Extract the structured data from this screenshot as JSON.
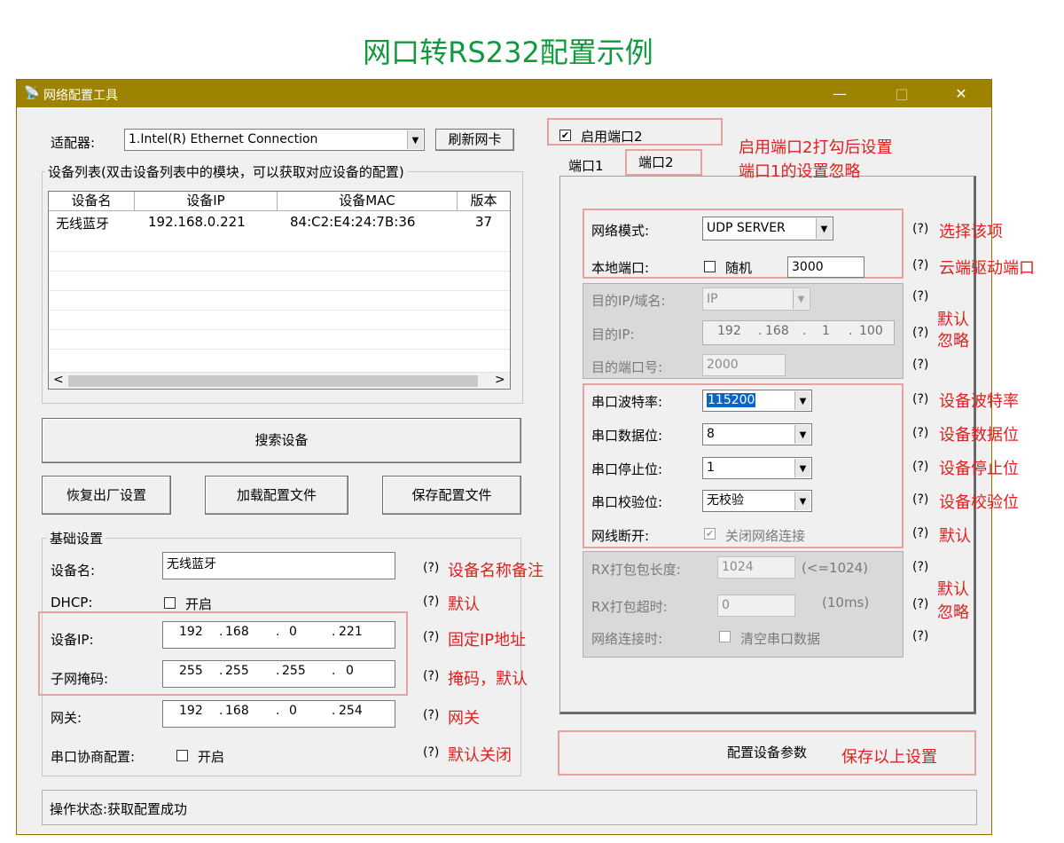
{
  "heading": "网口转RS232配置示例",
  "window": {
    "title": "网络配置工具",
    "minimize": "—",
    "maximize": "□",
    "close": "✕",
    "icon": "network-tool-icon"
  },
  "adapter": {
    "label": "适配器:",
    "value": "1.Intel(R) Ethernet Connection",
    "refresh_label": "刷新网卡"
  },
  "device_list": {
    "title": "设备列表(双击设备列表中的模块，可以获取对应设备的配置)",
    "columns": [
      "设备名",
      "设备IP",
      "设备MAC",
      "版本"
    ],
    "rows": [
      {
        "name": "无线蓝牙",
        "ip": "192.168.0.221",
        "mac": "84:C2:E4:24:7B:36",
        "version": "37"
      }
    ],
    "scroll_left": "<",
    "scroll_right": ">"
  },
  "buttons": {
    "search": "搜索设备",
    "factory_reset": "恢复出厂设置",
    "load_config": "加载配置文件",
    "save_config": "保存配置文件",
    "configure": "配置设备参数"
  },
  "basic": {
    "title": "基础设置",
    "device_name_label": "设备名:",
    "device_name_value": "无线蓝牙",
    "dhcp_label": "DHCP:",
    "dhcp_option": "开启",
    "ip_label": "设备IP:",
    "ip": [
      "192",
      "168",
      "0",
      "221"
    ],
    "mask_label": "子网掩码:",
    "mask": [
      "255",
      "255",
      "255",
      "0"
    ],
    "gateway_label": "网关:",
    "gateway": [
      "192",
      "168",
      "0",
      "254"
    ],
    "serial_neg_label": "串口协商配置:",
    "serial_neg_option": "开启"
  },
  "status": {
    "text": "操作状态:获取配置成功"
  },
  "port2": {
    "enable_label": "启用端口2",
    "enable_checked": "✔",
    "tabs": [
      "端口1",
      "端口2"
    ]
  },
  "port_settings": {
    "net_mode_label": "网络模式:",
    "net_mode_value": "UDP SERVER",
    "local_port_label": "本地端口:",
    "random_label": "随机",
    "local_port_value": "3000",
    "dest_host_label": "目的IP/域名:",
    "dest_host_value": "IP",
    "dest_ip_label": "目的IP:",
    "dest_ip": [
      "192",
      "168",
      "1",
      "100"
    ],
    "dest_port_label": "目的端口号:",
    "dest_port_value": "2000",
    "baud_label": "串口波特率:",
    "baud_value": "115200",
    "data_bits_label": "串口数据位:",
    "data_bits_value": "8",
    "stop_bits_label": "串口停止位:",
    "stop_bits_value": "1",
    "parity_label": "串口校验位:",
    "parity_value": "无校验",
    "disconnect_label": "网线断开:",
    "disconnect_option": "关闭网络连接",
    "disconnect_checked": "✔",
    "rx_len_label": "RX打包包长度:",
    "rx_len_value": "1024",
    "rx_len_hint": "(<=1024)",
    "rx_timeout_label": "RX打包超时:",
    "rx_timeout_value": "0",
    "rx_timeout_hint": "(10ms)",
    "connect_label": "网络连接时:",
    "connect_option": "清空串口数据"
  },
  "help_mark": "(?)",
  "annotations": {
    "enable_port2": "启用端口2打勾后设置",
    "port1_ignored": "端口1的设置忽略",
    "select_this": "选择该项",
    "cloud_port": "云端驱动端口",
    "default": "默认",
    "ignore": "忽略",
    "baud": "设备波特率",
    "data_bits": "设备数据位",
    "stop_bits": "设备停止位",
    "parity": "设备校验位",
    "name_note": "设备名称备注",
    "fixed_ip": "固定IP地址",
    "mask_default": "掩码，默认",
    "gateway": "网关",
    "default_off": "默认关闭",
    "save_above": "保存以上设置"
  },
  "colors": {
    "annotation": "#e02020",
    "heading": "#109a3d",
    "titlebar": "#9e8300",
    "highlight_box": "#e8a0a0"
  }
}
